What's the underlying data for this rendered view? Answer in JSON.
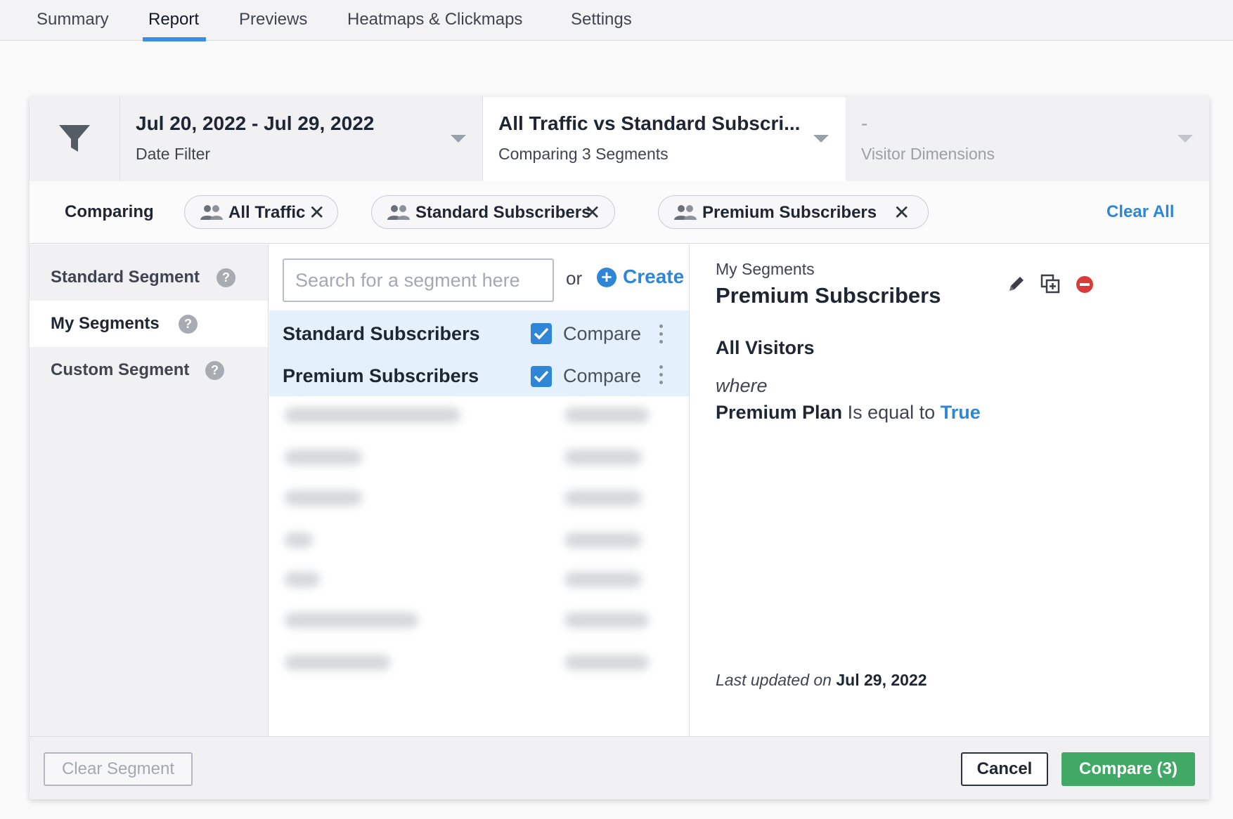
{
  "nav": {
    "tabs": [
      {
        "label": "Summary"
      },
      {
        "label": "Report"
      },
      {
        "label": "Previews"
      },
      {
        "label": "Heatmaps & Clickmaps"
      },
      {
        "label": "Settings"
      }
    ],
    "active_tab": "Report"
  },
  "filters": {
    "date": {
      "value": "Jul 20, 2022 - Jul 29, 2022",
      "label": "Date Filter"
    },
    "segment": {
      "value": "All Traffic vs Standard Subscri...",
      "label": "Comparing 3 Segments"
    },
    "visitor": {
      "value": "-",
      "label": "Visitor Dimensions"
    }
  },
  "comparing": {
    "label": "Comparing",
    "chips": [
      {
        "label": "All Traffic"
      },
      {
        "label": "Standard Subscribers"
      },
      {
        "label": "Premium Subscribers"
      }
    ],
    "clear_all": "Clear All"
  },
  "sidebar": {
    "items": [
      {
        "label": "Standard Segment",
        "help": "?"
      },
      {
        "label": "My Segments",
        "help": "?"
      },
      {
        "label": "Custom Segment",
        "help": "?"
      }
    ],
    "active": "My Segments"
  },
  "segment_list": {
    "search_placeholder": "Search for a segment here",
    "or_label": "or",
    "create_label": "Create",
    "rows": [
      {
        "name": "Standard Subscribers",
        "checked": true,
        "compare_label": "Compare"
      },
      {
        "name": "Premium Subscribers",
        "checked": true,
        "compare_label": "Compare"
      }
    ]
  },
  "detail": {
    "breadcrumb": "My Segments",
    "title": "Premium Subscribers",
    "audience": "All Visitors",
    "where": "where",
    "condition": {
      "field": "Premium Plan",
      "operator": "Is equal to",
      "value": "True"
    },
    "updated_label": "Last updated on",
    "updated_date": "Jul 29, 2022"
  },
  "footer": {
    "clear_segment": "Clear Segment",
    "cancel": "Cancel",
    "compare": "Compare (3)"
  },
  "colors": {
    "accent": "#2f86d6",
    "nav_underline": "#3b8ddf",
    "compare_button": "#41a866",
    "delete_icon": "#d93a3a"
  }
}
